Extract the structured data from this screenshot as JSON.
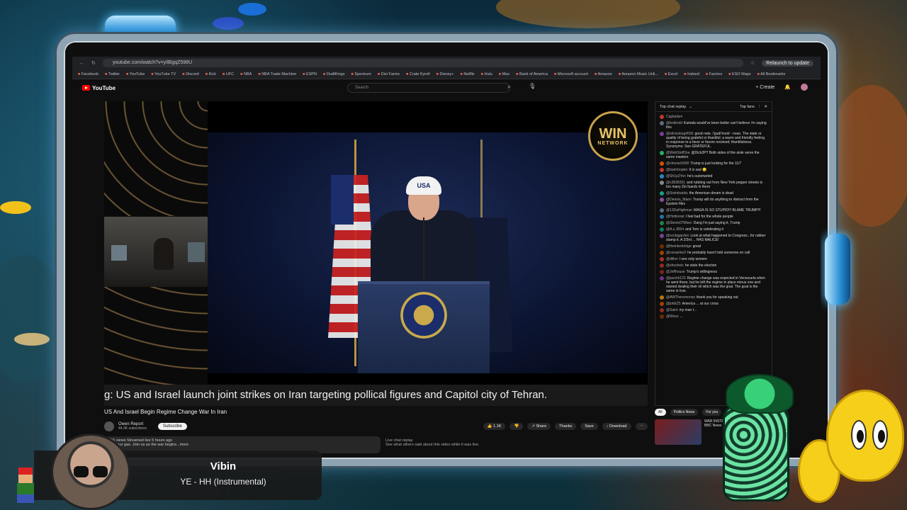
{
  "browser": {
    "url": "youtube.com/watch?v=yIlBgqZ598U",
    "relaunch_label": "Relaunch to update",
    "bookmarks": [
      "Facebook",
      "Twitter",
      "YouTube",
      "YouTube TV",
      "Discord",
      "Kick",
      "UFC",
      "NBA",
      "NBA Trade Machine",
      "ESPN",
      "DraftKings",
      "Spectrum",
      "Dixi Farms",
      "Crate Kyrell",
      "Disney+",
      "Netflix",
      "Hulu",
      "Max",
      "Bank of America",
      "Microsoft account",
      "Amazon",
      "Amazon Music Unli...",
      "Excel",
      "Indeed",
      "Factors",
      "ESO Maps",
      "All Bookmarks"
    ]
  },
  "youtube": {
    "logo_text": "YouTube",
    "search_placeholder": "Search",
    "create_label": "+ Create",
    "video": {
      "logo_top": "WIN",
      "logo_bottom": "NETWORK",
      "hat_text": "USA",
      "ticker": "g: US and Israel launch joint strikes on Iran targeting pollical figures and Capitol city of Tehran."
    },
    "title": "US And Israel Begin Regime Change War In Iran",
    "channel": {
      "name": "Owen Report",
      "subs": "44.3K subscribers",
      "subscribe_label": "Subscribe"
    },
    "actions": [
      "👍 1.1K",
      "👎",
      "↗ Share",
      "Thanks",
      "Save",
      "↓ Download",
      "⋯"
    ],
    "description": "256 views  Streamed live 5 hours ago",
    "description_sub": "...for our gas. Join us as the war begins...more",
    "live_replay_label": "Live chat replay",
    "live_replay_sub": "See what others said about this video while it was live.",
    "chat": {
      "header": "Top chat replay",
      "mode": "Top fans",
      "messages": [
        {
          "name": "Capitalism",
          "text": "",
          "color": "#c0392b"
        },
        {
          "name": "@bobhold",
          "text": "Kamala would've been better can't believe i'm saying this",
          "color": "#5d6d7e"
        },
        {
          "name": "@elivisobug4556",
          "text": "good note. /'gud/'noot/ - noun. The state or quality of being grateful or thankful; a warm and friendly feeling in response to a favor or favors received; thankfulness. Synonyms: See GRATEFUL.",
          "color": "#7d3c98"
        },
        {
          "name": "@WebStoff1ke",
          "text": "@Dick2PT Both sides of the aisle serve the same masters",
          "color": "#27ae60"
        },
        {
          "name": "@cherise5000",
          "text": "Trump is just looking for the 11/7",
          "color": "#d35400"
        },
        {
          "name": "@barinhopter",
          "text": "It is sad 😔",
          "color": "#c0392b"
        },
        {
          "name": "@Sh1p2Yon",
          "text": "he's outsmarted",
          "color": "#2e86c1"
        },
        {
          "name": "@c3838301",
          "text": "and rubbing out from New York pepper streets is too many Zio fuards in there",
          "color": "#7f8c8d"
        },
        {
          "name": "@Sisimbanks",
          "text": "the American dream is dead",
          "color": "#16a085"
        },
        {
          "name": "@Dennis_Mann",
          "text": "Trump will do anything to distract from the Epstein files",
          "color": "#884ea0"
        },
        {
          "name": "@13DaHighman",
          "text": "MAGA IS SO STUPID!!! BLAME TRUMP!!!",
          "color": "#5d6d7e"
        },
        {
          "name": "@Hottrenet",
          "text": "I feel bad for the whole people",
          "color": "#2471a3"
        },
        {
          "name": "@Stevie07Mixer",
          "text": "Dang I'm just saying it, Trump",
          "color": "#1e8449"
        },
        {
          "name": "@A.s.JB54",
          "text": "and Tom is celebrating it",
          "color": "#117a65"
        },
        {
          "name": "@scolagarden",
          "text": "Look at what happened to Congress...for rubber stamp it. A 2/3rd ... HAS MALICE!",
          "color": "#76448a"
        },
        {
          "name": "@theinterbridge",
          "text": "great",
          "color": "#6e2c00"
        },
        {
          "name": "@cerastine2",
          "text": "he probably hasn't told someone on call",
          "color": "#a04000"
        },
        {
          "name": "@dillon",
          "text": "I see only women",
          "color": "#a93226"
        },
        {
          "name": "@shusheis",
          "text": "he stole the election",
          "color": "#922b21"
        },
        {
          "name": "@Jeffhouse",
          "text": "Trump's willingness",
          "color": "#7b241c"
        },
        {
          "name": "@jaschk123",
          "text": "Regime change was expected in Venezuela when he went there, but he left the regime in place minus one and started dealing their oil which was the goal. The goal is the same in Iran.",
          "color": "#6c3483"
        },
        {
          "name": "@AWTheremoney",
          "text": "thank you for speaking out",
          "color": "#b9770e"
        },
        {
          "name": "@jokEZ5",
          "text": "America ... at our cross",
          "color": "#a04000"
        },
        {
          "name": "@Saint",
          "text": "my man t...",
          "color": "#922b21"
        },
        {
          "name": "@Wooz",
          "text": "...",
          "color": "#6e2c00"
        }
      ]
    },
    "chips": [
      "All",
      "Politics News",
      "For you"
    ],
    "thumb_text": "WAR INSTRIKE",
    "thumb_meta": "BBC News"
  },
  "overlay": {
    "song_title": "Vibin",
    "song_artist": "YE - HH (Instrumental)"
  }
}
